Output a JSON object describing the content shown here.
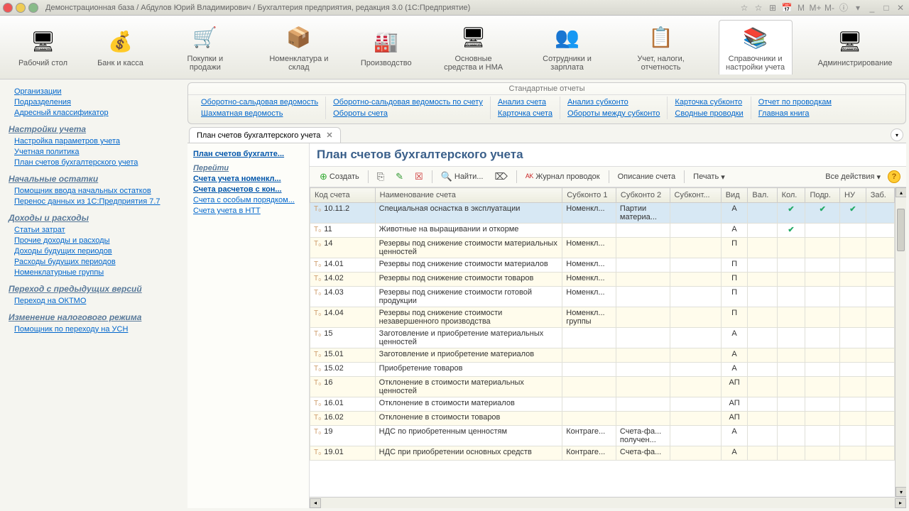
{
  "titlebar": {
    "title": "Демонстрационная база / Абдулов Юрий Владимирович / Бухгалтерия предприятия, редакция 3.0  (1С:Предприятие)",
    "icons": [
      "☆",
      "☆",
      "⊞",
      "📅",
      "M",
      "M+",
      "M-",
      "ⓘ",
      "▾",
      "_",
      "□",
      "✕"
    ]
  },
  "main_toolbar": [
    {
      "label": "Рабочий стол",
      "icon": "🖥"
    },
    {
      "label": "Банк и касса",
      "icon": "💰"
    },
    {
      "label": "Покупки и продажи",
      "icon": "🛒"
    },
    {
      "label": "Номенклатура и склад",
      "icon": "📦"
    },
    {
      "label": "Производство",
      "icon": "🏭"
    },
    {
      "label": "Основные средства и НМА",
      "icon": "🖥"
    },
    {
      "label": "Сотрудники и зарплата",
      "icon": "👥"
    },
    {
      "label": "Учет, налоги, отчетность",
      "icon": "📋"
    },
    {
      "label": "Справочники и настройки учета",
      "icon": "📚",
      "active": true
    },
    {
      "label": "Администрирование",
      "icon": "🖥"
    }
  ],
  "sidebar": {
    "top_links": [
      "Организации",
      "Подразделения",
      "Адресный классификатор"
    ],
    "groups": [
      {
        "title": "Настройки учета",
        "links": [
          "Настройка параметров учета",
          "Учетная политика",
          "План счетов бухгалтерского учета"
        ]
      },
      {
        "title": "Начальные остатки",
        "links": [
          "Помощник ввода начальных остатков",
          "Перенос данных из 1С:Предприятия 7.7"
        ]
      },
      {
        "title": "Доходы и расходы",
        "links": [
          "Статьи затрат",
          "Прочие доходы и расходы",
          "Доходы будущих периодов",
          "Расходы будущих периодов",
          "Номенклатурные группы"
        ]
      },
      {
        "title": "Переход с предыдущих версий",
        "links": [
          "Переход на ОКТМО"
        ]
      },
      {
        "title": "Изменение налогового режима",
        "links": [
          "Помощник по переходу на УСН"
        ]
      }
    ]
  },
  "reports": {
    "title": "Стандартные отчеты",
    "cols": [
      [
        "Оборотно-сальдовая ведомость",
        "Шахматная ведомость"
      ],
      [
        "Оборотно-сальдовая ведомость по счету",
        "Обороты счета"
      ],
      [
        "Анализ счета",
        "Карточка счета"
      ],
      [
        "Анализ субконто",
        "Обороты между субконто"
      ],
      [
        "Карточка субконто",
        "Сводные проводки"
      ],
      [
        "Отчет по проводкам",
        "Главная книга"
      ]
    ]
  },
  "tab": {
    "label": "План счетов бухгалтерского учета"
  },
  "left_panel": {
    "top": "План счетов бухгалте...",
    "header": "Перейти",
    "bold1": "Счета учета номенкл...",
    "bold2": "Счета расчетов с кон...",
    "links": [
      "Счета с особым порядком...",
      "Счета учета в НТТ"
    ]
  },
  "page": {
    "title": "План счетов бухгалтерского учета"
  },
  "toolbar": {
    "create": "Создать",
    "find": "Найти...",
    "journal": "Журнал проводок",
    "descr": "Описание счета",
    "print": "Печать",
    "all": "Все действия"
  },
  "columns": [
    "Код счета",
    "Наименование счета",
    "Субконто 1",
    "Субконто 2",
    "Субконт...",
    "Вид",
    "Вал.",
    "Кол.",
    "Подр.",
    "НУ",
    "Заб."
  ],
  "rows": [
    {
      "code": "10.11.2",
      "name": "Специальная оснастка в эксплуатации",
      "s1": "Номенкл...",
      "s2": "Партии материа...",
      "vid": "А",
      "kol": "✔",
      "podr": "✔",
      "nu": "✔",
      "sel": true
    },
    {
      "code": "11",
      "name": "Животные на выращивании и откорме",
      "vid": "А",
      "kol": "✔"
    },
    {
      "code": "14",
      "name": "Резервы под снижение стоимости материальных ценностей",
      "s1": "Номенкл...",
      "vid": "П",
      "alt": true
    },
    {
      "code": "14.01",
      "name": "Резервы под снижение стоимости материалов",
      "s1": "Номенкл...",
      "vid": "П"
    },
    {
      "code": "14.02",
      "name": "Резервы под снижение стоимости товаров",
      "s1": "Номенкл...",
      "vid": "П",
      "alt": true
    },
    {
      "code": "14.03",
      "name": "Резервы под снижение стоимости готовой продукции",
      "s1": "Номенкл...",
      "vid": "П"
    },
    {
      "code": "14.04",
      "name": "Резервы под снижение стоимости незавершенного производства",
      "s1": "Номенкл... группы",
      "vid": "П",
      "alt": true
    },
    {
      "code": "15",
      "name": "Заготовление и приобретение материальных ценностей",
      "vid": "А"
    },
    {
      "code": "15.01",
      "name": "Заготовление и приобретение материалов",
      "vid": "А",
      "alt": true
    },
    {
      "code": "15.02",
      "name": "Приобретение товаров",
      "vid": "А"
    },
    {
      "code": "16",
      "name": "Отклонение в стоимости материальных ценностей",
      "vid": "АП",
      "alt": true
    },
    {
      "code": "16.01",
      "name": "Отклонение в стоимости материалов",
      "vid": "АП"
    },
    {
      "code": "16.02",
      "name": "Отклонение в стоимости товаров",
      "vid": "АП",
      "alt": true
    },
    {
      "code": "19",
      "name": "НДС по приобретенным ценностям",
      "s1": "Контраге...",
      "s2": "Счета-фа... получен...",
      "vid": "А"
    },
    {
      "code": "19.01",
      "name": "НДС при приобретении основных средств",
      "s1": "Контраге...",
      "s2": "Счета-фа...",
      "vid": "А",
      "alt": true
    }
  ]
}
